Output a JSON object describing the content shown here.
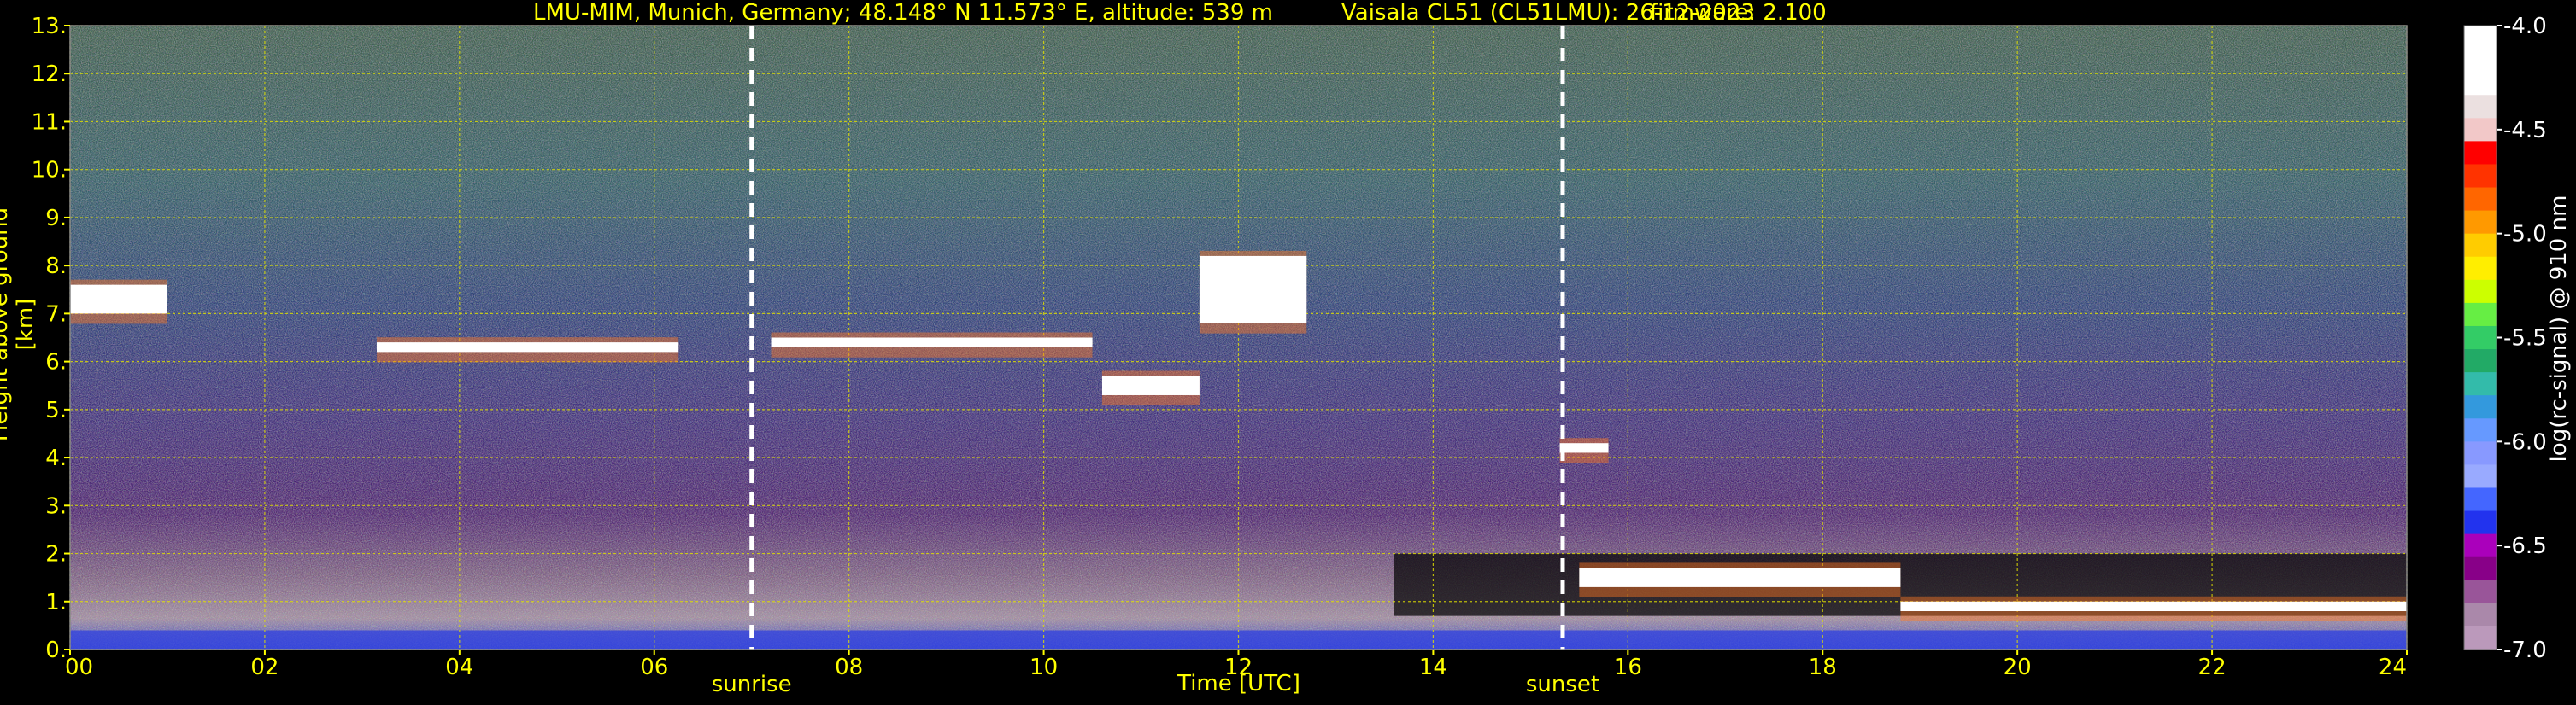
{
  "title": {
    "location": "LMU-MIM, Munich, Germany; 48.148° N 11.573° E, altitude: 539 m",
    "instrument": "Vaisala CL51 (CL51LMU): 26-12-2023",
    "firmware": "firmware: 2.100"
  },
  "chart_data": {
    "type": "heatmap",
    "xlabel": "Time [UTC]",
    "ylabel": "Height above ground [km]",
    "colorbar_label": "log(rc-signal) @ 910 nm",
    "xlim": [
      0,
      24
    ],
    "ylim": [
      0,
      13
    ],
    "x_ticks": [
      "00",
      "02",
      "04",
      "06",
      "08",
      "10",
      "12",
      "14",
      "16",
      "18",
      "20",
      "22",
      "24"
    ],
    "x_tick_values": [
      0,
      2,
      4,
      6,
      8,
      10,
      12,
      14,
      16,
      18,
      20,
      22,
      24
    ],
    "y_ticks": [
      "0.",
      "1.",
      "2.",
      "3.",
      "4.",
      "5.",
      "6.",
      "7.",
      "8.",
      "9.",
      "10.",
      "11.",
      "12.",
      "13."
    ],
    "y_tick_values": [
      0,
      1,
      2,
      3,
      4,
      5,
      6,
      7,
      8,
      9,
      10,
      11,
      12,
      13
    ],
    "grid": true,
    "colorbar": {
      "range": [
        -7.0,
        -4.0
      ],
      "ticks": [
        "-4.0",
        "-4.5",
        "-5.0",
        "-5.5",
        "-6.0",
        "-6.5",
        "-7.0"
      ],
      "tick_values": [
        -4.0,
        -4.5,
        -5.0,
        -5.5,
        -6.0,
        -6.5,
        -7.0
      ],
      "colors": [
        "#ffffff",
        "#ffffff",
        "#ffffff",
        "#ebe0e0",
        "#f2c8c8",
        "#ff0000",
        "#ff3300",
        "#ff6600",
        "#ff9900",
        "#ffcc00",
        "#ffee00",
        "#ccff00",
        "#66ee44",
        "#33cc66",
        "#22aa66",
        "#33bbaa",
        "#3399dd",
        "#6699ff",
        "#8899ff",
        "#99aaff",
        "#4466ff",
        "#2233ee",
        "#aa00bb",
        "#880088",
        "#995599",
        "#aa88aa",
        "#bb99bb"
      ]
    },
    "markers": [
      {
        "label": "sunrise",
        "x": 7.0
      },
      {
        "label": "sunset",
        "x": 15.33
      }
    ],
    "cloud_layers": [
      {
        "x0": 0.0,
        "x1": 1.0,
        "y": 7.3,
        "thickness": 0.6
      },
      {
        "x0": 3.15,
        "x1": 6.25,
        "y": 6.3,
        "thickness": 0.2
      },
      {
        "x0": 7.2,
        "x1": 10.5,
        "y": 6.4,
        "thickness": 0.2
      },
      {
        "x0": 10.6,
        "x1": 11.6,
        "y": 5.5,
        "thickness": 0.4
      },
      {
        "x0": 11.6,
        "x1": 12.7,
        "y": 7.5,
        "thickness": 1.4
      },
      {
        "x0": 15.3,
        "x1": 15.8,
        "y": 4.2,
        "thickness": 0.2
      },
      {
        "x0": 15.5,
        "x1": 18.8,
        "y": 1.5,
        "thickness": 0.4
      },
      {
        "x0": 18.8,
        "x1": 24.0,
        "y": 0.9,
        "thickness": 0.2
      }
    ]
  }
}
